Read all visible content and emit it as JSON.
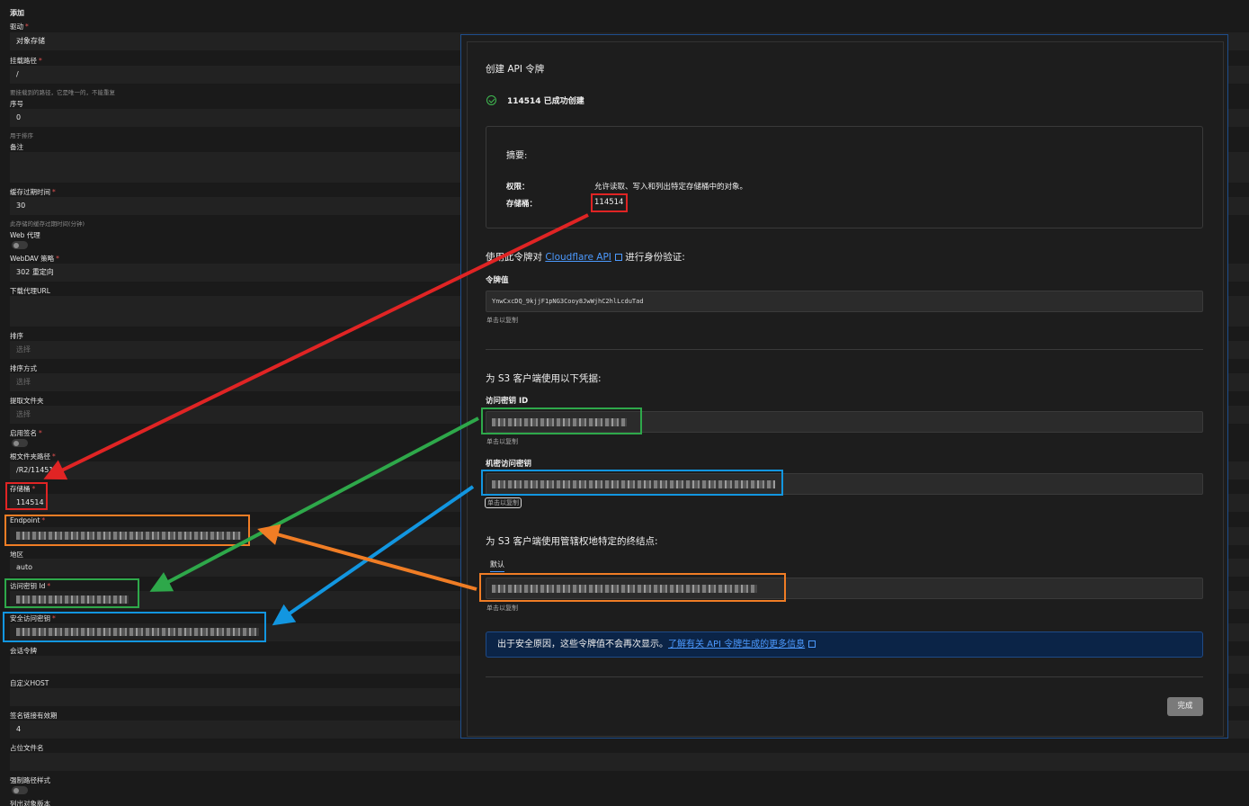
{
  "form": {
    "title": "添加",
    "driver_label": "驱动",
    "driver_value": "对象存储",
    "mount_label": "挂载路径",
    "mount_value": "/",
    "mount_hint": "要挂载到的路径，它是唯一的，不能重复",
    "order_label": "序号",
    "order_value": "0",
    "order_hint": "用于排序",
    "remark_label": "备注",
    "cache_label": "缓存过期时间",
    "cache_value": "30",
    "cache_hint": "此存储的缓存过期时间(分钟)",
    "webproxy_label": "Web 代理",
    "webdav_label": "WebDAV 策略",
    "webdav_value": "302 重定向",
    "download_proxy_label": "下载代理URL",
    "sort_label": "排序",
    "sort_placeholder": "选择",
    "sort_dir_label": "排序方式",
    "sort_dir_placeholder": "选择",
    "extract_label": "提取文件夹",
    "extract_placeholder": "选择",
    "sign_label": "启用签名",
    "root_label": "根文件夹路径",
    "root_value": "/R2/114514",
    "bucket_label": "存储桶",
    "bucket_value": "114514",
    "endpoint_label": "Endpoint",
    "region_label": "地区",
    "region_value": "auto",
    "access_id_label": "访问密钥 Id",
    "secret_label": "安全访问密钥",
    "session_label": "会话令牌",
    "host_label": "自定义HOST",
    "sign_expire_label": "签名链接有效期",
    "sign_expire_value": "4",
    "placeholder_label": "占位文件名",
    "force_path_label": "强制路径样式",
    "list_version_label": "列出对象版本"
  },
  "modal": {
    "title": "创建 API 令牌",
    "success_text": "114514 已成功创建",
    "summary_title": "摘要:",
    "permission_key": "权限：",
    "permission_value": "允许读取、写入和列出特定存储桶中的对象。",
    "bucket_key": "存储桶：",
    "bucket_value": "114514",
    "auth_prefix": "使用此令牌对",
    "auth_link": "Cloudflare API",
    "auth_suffix": "进行身份验证:",
    "token_label": "令牌值",
    "token_value": "YnwCxcDQ_9kjjF1pNG3Cooy8JwWjhC2hlLcduTad",
    "copy_hint": "单击以复制",
    "s3_creds_title": "为 S3 客户端使用以下凭据:",
    "access_id_label": "访问密钥 ID",
    "secret_label": "机密访问密钥",
    "endpoint_title": "为 S3 客户端使用管辖权地特定的终结点:",
    "endpoint_tab": "默认",
    "info_text": "出于安全原因，这些令牌值不会再次显示。",
    "info_link": "了解有关 API 令牌生成的更多信息",
    "done_label": "完成"
  },
  "colors": {
    "red": "#e02424",
    "green": "#2ea84a",
    "blue": "#1296e0",
    "orange": "#f07d25",
    "link": "#4c9aff"
  }
}
